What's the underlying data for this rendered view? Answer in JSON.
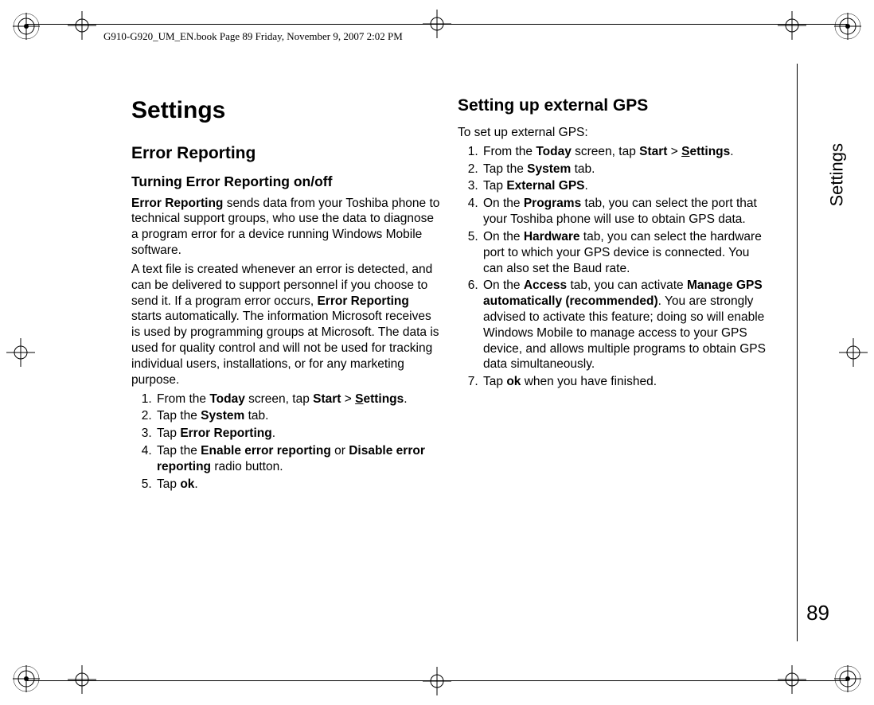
{
  "frame_header": "G910-G920_UM_EN.book  Page 89  Friday, November 9, 2007  2:02 PM",
  "side_label": "Settings",
  "page_number": "89",
  "title": "Settings",
  "left": {
    "section": "Error Reporting",
    "subsection": "Turning Error Reporting on/off",
    "para1_pre": "Error Reporting",
    "para1_post": " sends data from your Toshiba phone to technical support groups, who use the data to diagnose a program error for a device running Windows Mobile software.",
    "para2_pre": "A text file is created whenever an error is detected, and can be delivered to support personnel if you choose to send it. If a program error occurs, ",
    "para2_bold": "Error Reporting",
    "para2_post": " starts automatically. The information Microsoft receives is used by programming groups at Microsoft. The data is used for quality control and will not be used for tracking individual users, installations, or for any marketing purpose.",
    "step1_a": "From the ",
    "step1_b": "Today",
    "step1_c": " screen, tap ",
    "step1_d": "Start",
    "step1_e": " > ",
    "step1_f_key": "S",
    "step1_f_rest": "ettings",
    "step1_g": ".",
    "step2_a": "Tap the ",
    "step2_b": "System",
    "step2_c": " tab.",
    "step3_a": "Tap ",
    "step3_b": "Error Reporting",
    "step3_c": ".",
    "step4_a": "Tap the ",
    "step4_b": "Enable error reporting",
    "step4_c": " or ",
    "step4_d": "Disable error reporting",
    "step4_e": " radio button.",
    "step5_a": "Tap ",
    "step5_b": "ok",
    "step5_c": "."
  },
  "right": {
    "section": "Setting up external GPS",
    "intro": "To set up external GPS:",
    "step1_a": "From the ",
    "step1_b": "Today",
    "step1_c": " screen, tap ",
    "step1_d": "Start",
    "step1_e": " > ",
    "step1_f_key": "S",
    "step1_f_rest": "ettings",
    "step1_g": ".",
    "step2_a": "Tap the ",
    "step2_b": "System",
    "step2_c": " tab.",
    "step3_a": "Tap ",
    "step3_b": "External GPS",
    "step3_c": ".",
    "step4_a": "On the ",
    "step4_b": "Programs",
    "step4_c": " tab, you can select the port that your Toshiba phone will use to obtain GPS data.",
    "step5_a": "On the ",
    "step5_b": "Hardware",
    "step5_c": " tab, you can select the hardware port to which your GPS device is connected. You can also set the Baud rate.",
    "step6_a": "On the ",
    "step6_b": "Access",
    "step6_c": " tab, you can activate ",
    "step6_d": "Manage GPS automatically (recommended)",
    "step6_e": ". You are strongly advised to activate this feature; doing so will enable Windows Mobile to manage access to your GPS device, and allows multiple programs to obtain GPS data simultaneously.",
    "step7_a": "Tap ",
    "step7_b": "ok",
    "step7_c": " when you have finished."
  }
}
